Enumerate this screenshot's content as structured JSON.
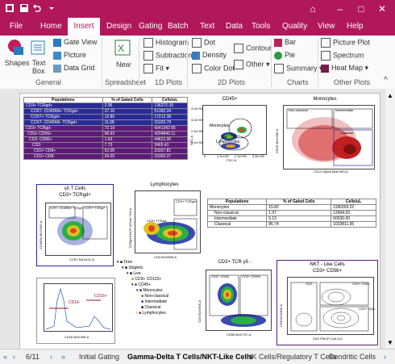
{
  "app": {
    "title_icons": [
      "app-icon",
      "save-icon",
      "undo-icon",
      "dropdown-icon"
    ]
  },
  "window": {
    "minimize": "–",
    "restore": "□",
    "close": "✕",
    "ribbon_toggle": "⌂"
  },
  "menu": [
    "File",
    "Home",
    "Insert",
    "Design",
    "Gating",
    "Batch",
    "Text",
    "Data",
    "Tools",
    "Quality",
    "View",
    "Help"
  ],
  "ribbon": {
    "shapes": "Shapes",
    "text": "Text",
    "box": "Box",
    "gate_view": "Gate View",
    "picture": "Picture",
    "data_grid": "Data Grid",
    "new": "New",
    "histogram": "Histogram",
    "subtraction": "Subtraction",
    "fit": "Fit",
    "dot": "Dot",
    "density": "Density",
    "color_dot": "Color Dot",
    "contour": "Contour",
    "other": "Other",
    "bar": "Bar",
    "pie": "Pie",
    "summary": "Summary",
    "picture_plot": "Picture Plot",
    "spectrum": "Spectrum",
    "heat_map": "Heat Map",
    "groups": {
      "general": "General",
      "spreadsheet": "Spreadsheet",
      "plots1d": "1D Plots",
      "plots2d": "2D Plots",
      "charts": "Charts",
      "other": "Other Plots"
    }
  },
  "table1": {
    "headers": [
      "Populations",
      "% of Gated Cells",
      "Cells/uL"
    ],
    "rows": [
      [
        "CD3+ TCRgd+",
        "2.96",
        "136272.39"
      ],
      [
        "CCR7- CD45RA+ TCRgd+",
        "37.16",
        "51382.34"
      ],
      [
        "CCR7+ TCRgd+",
        "12.86",
        "17212.38"
      ],
      [
        "CCR7- CD45RA- TCRgd+",
        "11.08",
        "15320.79"
      ],
      [
        "CD3+ TCRgd-",
        "72.19",
        "4341342.65"
      ],
      [
        "CD3+ CD56+",
        "96.93",
        "4294840.11"
      ],
      [
        "CD3- CD56+",
        "1.63",
        "44621.00"
      ],
      [
        "CD2-",
        "7.73",
        "3465.41"
      ],
      [
        "CD2+ CD8+",
        "52.05",
        "23327.81"
      ],
      [
        "CD2+ CD8-",
        "34.25",
        "15352.27"
      ]
    ]
  },
  "table2": {
    "headers": [
      "Populations",
      "% of Gated Cells",
      "Cells/uL"
    ],
    "rows": [
      [
        "Monocytes",
        "15.82",
        "1180303.22"
      ],
      [
        "Non-classical",
        "1.07",
        "12664.03"
      ],
      [
        "Intermediate",
        "5.13",
        "60530.00"
      ],
      [
        "Classical",
        "86.74",
        "1023811.95"
      ]
    ]
  },
  "plots": {
    "cd45": {
      "title": "CD45+",
      "x": "FSC-A",
      "y": "SSC-A",
      "gate1": "Monocytes",
      "gate2": "Lymphocytes",
      "ticks_y": [
        "4.2e+05",
        "3.2e+05",
        "2.1e+05",
        "1.1e+05"
      ],
      "ticks_x": [
        "0",
        "1.1e+05",
        "2.1e+05",
        "3.2e+05"
      ]
    },
    "monocytes": {
      "title": "Monocytes",
      "x": "CD14 Spark Blue 550-A",
      "y": "CD16 BUV496-A",
      "g1": "Non-classical",
      "g2": "Intermediate",
      "g3": "Classical"
    },
    "gdt": {
      "title": "γδ T Cells",
      "subtitle": "CD3+ TCRgd+",
      "x": "CCR7 BUV421-A",
      "y": "CD45RA BUV395-A",
      "g1": "CCR7- CD45RA+ TCRgd+",
      "g2": "CCR7+ TCRgd+"
    },
    "lymph": {
      "title": "Lymphocytes",
      "x": "CD3 BUV805-A",
      "y": "TCRgd PerCP-eFluor 710-A",
      "g1": "CD3+ TCRgd+",
      "g2": "CD3+ TCRgd-"
    },
    "cd3tcr": {
      "title": "CD3+ TCR γδ -",
      "x": "CD56 BUV737-A",
      "y": "CD3 BUV805-A",
      "g1": "CD3+ CD56-",
      "g2": "CD3+ CD56+"
    },
    "nkt": {
      "title": "NKT - Like Cells",
      "subtitle": "CD3+ CD56+",
      "x": "CD2 PerCP-Cy5.5-A",
      "y": "CD8 BUV805-A",
      "g1": "CD2-",
      "g2": "CD2+ CD8+",
      "g3": "CD2+ CD8-"
    },
    "hist": {
      "x": "CD16 BUV496-A",
      "g1": "CD16-",
      "g2": "CD16+"
    },
    "tree": [
      "Time",
      "Singlets",
      "Live",
      "CD3+ CD123+",
      "CD45+",
      "Monocytes",
      "Non-classical",
      "Intermediate",
      "Classical",
      "Lymphocytes"
    ]
  },
  "tabs": {
    "page": "6/11",
    "items": [
      "Initial Gating",
      "Gamma-Delta T Cells/NKT-Like Cells",
      "NK Cells/Regulatory T Cells",
      "Dendritic Cells"
    ]
  },
  "colors": {
    "brand": "#b0185a",
    "table_blue": "#2a2a9a",
    "table_purple": "#5e1a7a"
  }
}
